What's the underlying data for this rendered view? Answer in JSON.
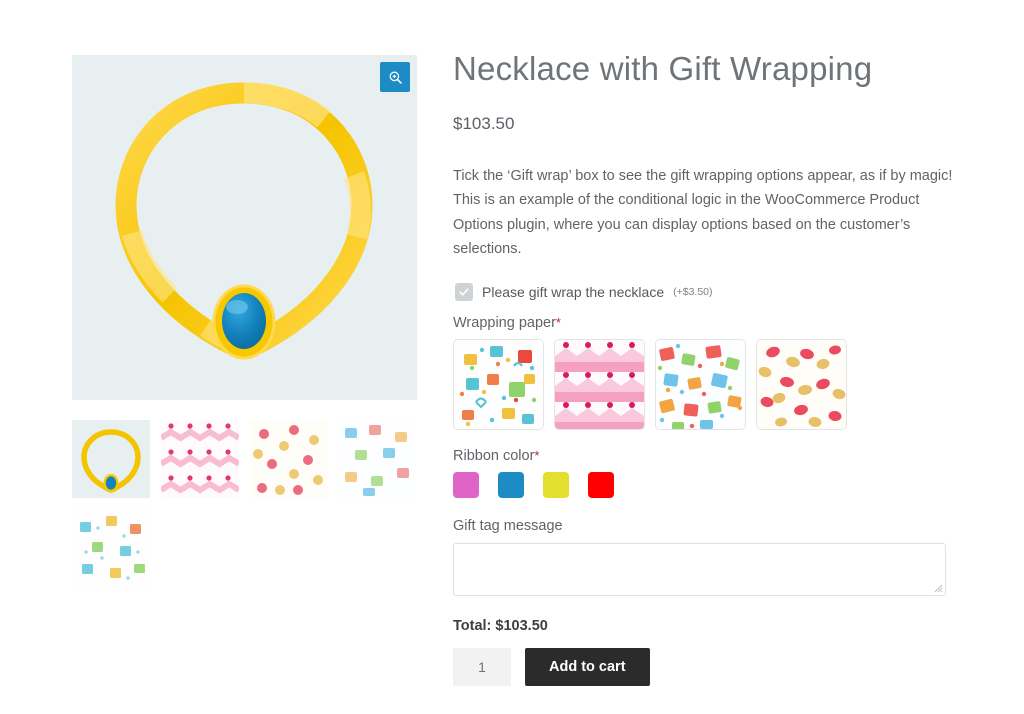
{
  "product": {
    "title": "Necklace with Gift Wrapping",
    "price": "$103.50",
    "description": "Tick the ‘Gift wrap’ box to see the gift wrapping options appear, as if by magic! This is an example of the conditional logic in the WooCommerce Product Options plugin, where you can display options based on the customer’s selections."
  },
  "gallery": {
    "zoom_icon": "magnifier-plus-icon",
    "main_alt": "gold-necklace-with-blue-gem",
    "thumbs": [
      {
        "name": "necklace-thumb",
        "type": "necklace",
        "active": true
      },
      {
        "name": "pink-hearts-paper-thumb",
        "type": "hearts"
      },
      {
        "name": "red-gold-bows-paper-thumb",
        "type": "bows"
      },
      {
        "name": "colorful-gifts-paper-thumb",
        "type": "gifts-colorful"
      },
      {
        "name": "gift-boxes-paper-thumb",
        "type": "gifts-boxes"
      }
    ]
  },
  "options": {
    "gift_wrap": {
      "label": "Please gift wrap the necklace",
      "price_suffix": "(+$3.50)",
      "checked": true,
      "icon": "check-icon"
    },
    "wrapping_paper": {
      "label": "Wrapping paper",
      "required": true,
      "required_marker": "*",
      "choices": [
        {
          "name": "gift-boxes",
          "pattern": "gifts-boxes"
        },
        {
          "name": "pink-hearts",
          "pattern": "hearts"
        },
        {
          "name": "colorful-gifts",
          "pattern": "gifts-colorful"
        },
        {
          "name": "red-gold-bows",
          "pattern": "bows"
        }
      ]
    },
    "ribbon_color": {
      "label": "Ribbon color",
      "required": true,
      "required_marker": "*",
      "choices": [
        {
          "name": "pink",
          "hex": "#e063c7"
        },
        {
          "name": "blue",
          "hex": "#1e8cc4"
        },
        {
          "name": "yellow",
          "hex": "#e2e02d"
        },
        {
          "name": "red",
          "hex": "#fe0000"
        }
      ]
    },
    "gift_tag_message": {
      "label": "Gift tag message",
      "value": "",
      "placeholder": ""
    }
  },
  "footer": {
    "total_label": "Total: $103.50",
    "quantity": "1",
    "add_to_cart_label": "Add to cart"
  },
  "colors": {
    "accent": "#1e8cc4",
    "button": "#2b2b2b",
    "required": "#b32d2e",
    "image_bg": "#e8eff0"
  }
}
